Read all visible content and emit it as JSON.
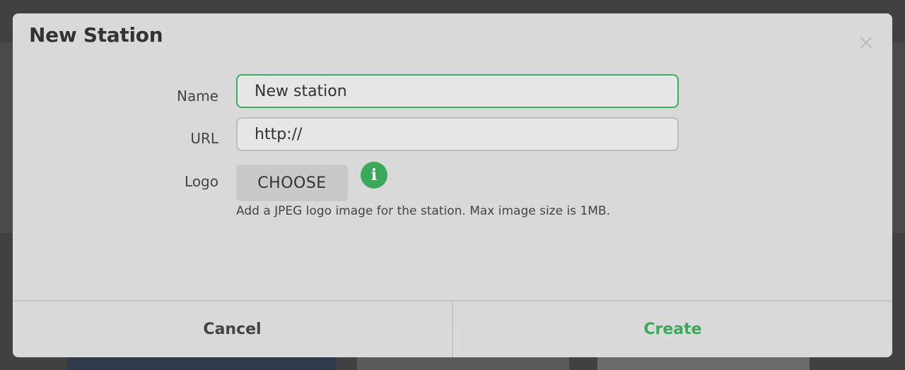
{
  "modal": {
    "title": "New Station",
    "close_glyph": "×"
  },
  "form": {
    "name": {
      "label": "Name",
      "value": "New station"
    },
    "url": {
      "label": "URL",
      "value": "http://"
    },
    "logo": {
      "label": "Logo",
      "button_label": "CHOOSE",
      "info_glyph": "i",
      "help_text": "Add a JPEG logo image for the station. Max image size is 1MB."
    }
  },
  "footer": {
    "cancel_label": "Cancel",
    "create_label": "Create"
  },
  "icons": {
    "close": "close-icon",
    "info": "info-icon"
  },
  "colors": {
    "accent": "#3aaa5a",
    "focus_border": "#3cae5d",
    "text": "#333333"
  }
}
